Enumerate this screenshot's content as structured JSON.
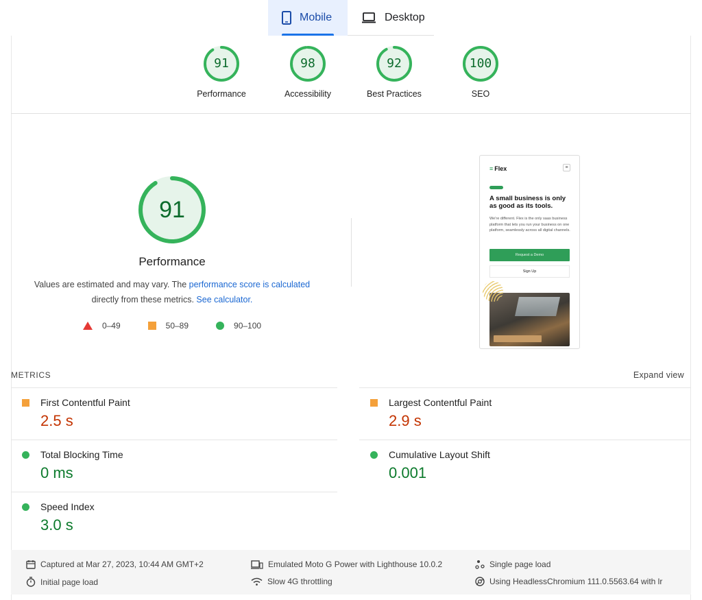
{
  "tabs": [
    {
      "label": "Mobile",
      "active": true,
      "icon": "smartphone-icon"
    },
    {
      "label": "Desktop",
      "active": false,
      "icon": "laptop-icon"
    }
  ],
  "gauges": [
    {
      "label": "Performance",
      "score": "91",
      "value": 0.91
    },
    {
      "label": "Accessibility",
      "score": "98",
      "value": 0.98
    },
    {
      "label": "Best Practices",
      "score": "92",
      "value": 0.92
    },
    {
      "label": "SEO",
      "score": "100",
      "value": 1.0
    }
  ],
  "performance": {
    "score": "91",
    "value": 0.91,
    "title": "Performance",
    "desc_prefix": "Values are estimated and may vary. The ",
    "desc_link1": "performance score is calculated",
    "desc_mid": "directly from these metrics. ",
    "desc_link2": "See calculator."
  },
  "legend": {
    "fail": "0–49",
    "average": "50–89",
    "pass": "90–100"
  },
  "thumbnail": {
    "brand": "Flex",
    "menu_glyph": "≡",
    "headline": "A small business is only as good as its tools.",
    "copy": "We're different. Flex is the only saas business platform that lets you run your business on one platform, seamlessly across all digital channels.",
    "cta_primary": "Request a Demo",
    "cta_secondary": "Sign Up"
  },
  "metrics": {
    "title": "METRICS",
    "expand_label": "Expand view",
    "items": [
      {
        "name": "First Contentful Paint",
        "value": "2.5 s",
        "rating": "average"
      },
      {
        "name": "Largest Contentful Paint",
        "value": "2.9 s",
        "rating": "average"
      },
      {
        "name": "Total Blocking Time",
        "value": "0 ms",
        "rating": "pass"
      },
      {
        "name": "Cumulative Layout Shift",
        "value": "0.001",
        "rating": "pass"
      },
      {
        "name": "Speed Index",
        "value": "3.0 s",
        "rating": "pass"
      }
    ]
  },
  "footer": {
    "captured": "Captured at Mar 27, 2023, 10:44 AM GMT+2",
    "initial_load": "Initial page load",
    "emulated": "Emulated Moto G Power with Lighthouse 10.0.2",
    "throttling": "Slow 4G throttling",
    "single_load": "Single page load",
    "browser": "Using HeadlessChromium 111.0.5563.64 with lr"
  },
  "colors": {
    "pass": "#0c6b2c",
    "pass_ring": "#35b35b",
    "pass_bg": "#e6f4ea",
    "average": "#f4a03a",
    "average_text": "#c33300",
    "fail": "#e53935",
    "link": "#1a67d2",
    "tab_active_bg": "#e8f0fe"
  }
}
